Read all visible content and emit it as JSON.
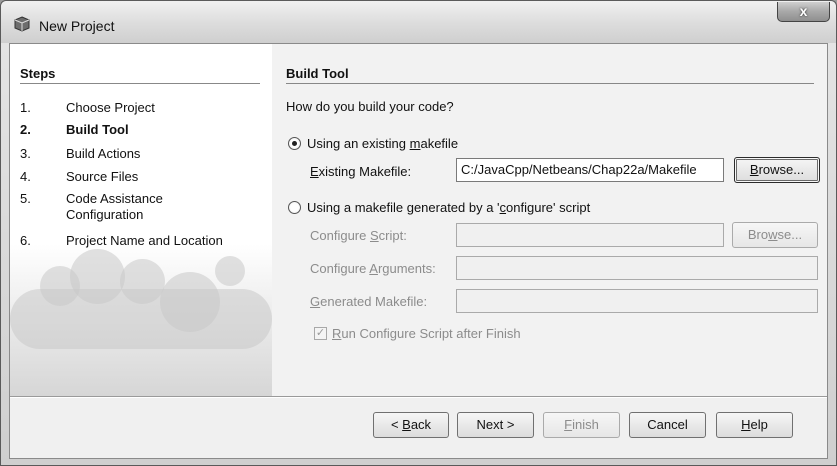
{
  "window": {
    "title": "New Project",
    "close_label": "x"
  },
  "steps": {
    "heading": "Steps",
    "items": [
      {
        "num": "1.",
        "label": "Choose Project"
      },
      {
        "num": "2.",
        "label": "Build Tool"
      },
      {
        "num": "3.",
        "label": "Build Actions"
      },
      {
        "num": "4.",
        "label": "Source Files"
      },
      {
        "num": "5.",
        "label": "Code Assistance Configuration"
      },
      {
        "num": "6.",
        "label": "Project Name and Location"
      }
    ],
    "current_index": 1
  },
  "content": {
    "heading": "Build Tool",
    "question": "How do you build your code?",
    "option_existing": {
      "label_pre": "Using an existing ",
      "label_u": "m",
      "label_post": "akefile",
      "selected": true
    },
    "existing_makefile_label_u": "E",
    "existing_makefile_label_rest": "xisting Makefile:",
    "existing_makefile_value": "C:/JavaCpp/Netbeans/Chap22a/Makefile",
    "browse1": {
      "pre": "",
      "u": "B",
      "post": "rowse..."
    },
    "option_configure": {
      "label_pre": "Using a makefile generated by a '",
      "label_u": "c",
      "label_post": "onfigure' script",
      "selected": false
    },
    "configure_script_label_pre": "Configure ",
    "configure_script_label_u": "S",
    "configure_script_label_post": "cript:",
    "browse2": {
      "pre": "Bro",
      "u": "w",
      "post": "se..."
    },
    "configure_args_label_pre": "Configure ",
    "configure_args_label_u": "A",
    "configure_args_label_post": "rguments:",
    "generated_makefile_label_u": "G",
    "generated_makefile_label_rest": "enerated Makefile:",
    "run_configure": {
      "u": "R",
      "rest": "un Configure Script after Finish",
      "checked": true
    }
  },
  "footer": {
    "back": {
      "pre": "< ",
      "u": "B",
      "post": "ack"
    },
    "next": "Next >",
    "finish": {
      "u": "F",
      "post": "inish"
    },
    "cancel": "Cancel",
    "help": {
      "u": "H",
      "post": "elp"
    }
  }
}
